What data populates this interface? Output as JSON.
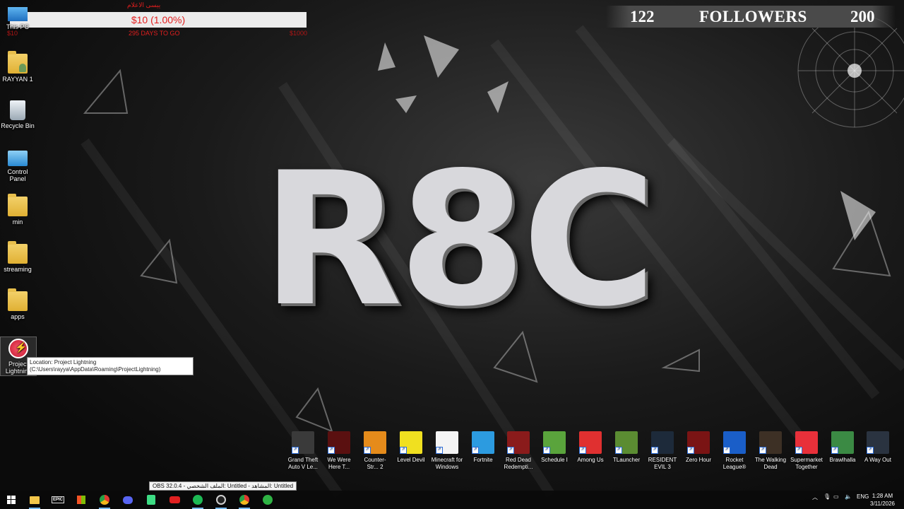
{
  "overlays": {
    "goal": {
      "top_label": "ييسى الاعلام",
      "bar_text": "$10 (1.00%)",
      "days_left": "295 DAYS TO GO",
      "left_value": "$10",
      "right_value": "$1000"
    },
    "followers": {
      "current": "122",
      "label": "FOLLOWERS",
      "goal": "200"
    }
  },
  "desktop_icons": [
    {
      "label": "This PC",
      "icon": "computer-icon"
    },
    {
      "label": "RAYYAN 1",
      "icon": "user-folder-icon"
    },
    {
      "label": "Recycle Bin",
      "icon": "recycle-bin-icon"
    },
    {
      "label": "Control Panel",
      "icon": "control-panel-icon"
    },
    {
      "label": "min",
      "icon": "folder-icon"
    },
    {
      "label": "streaming",
      "icon": "folder-icon"
    },
    {
      "label": "apps",
      "icon": "folder-icon"
    },
    {
      "label": "Project Lightning",
      "icon": "lightning-icon"
    }
  ],
  "tooltip": "Location: Project Lightning (C:\\Users\\rayya\\AppData\\Roaming\\ProjectLightning)",
  "wallpaper_logo": "R8C",
  "game_icons": [
    {
      "label": "Grand Theft Auto V Le...",
      "color": "#3a3a3a"
    },
    {
      "label": "We Were Here T...",
      "color": "#5a1010"
    },
    {
      "label": "Counter-Str... 2",
      "color": "#e58b1b"
    },
    {
      "label": "Level Devil",
      "color": "#f0e020"
    },
    {
      "label": "Minecraft for Windows",
      "color": "#f4f4f4"
    },
    {
      "label": "Fortnite",
      "color": "#2c9be0"
    },
    {
      "label": "Red Dead Redempti...",
      "color": "#8a1b1b"
    },
    {
      "label": "Schedule I",
      "color": "#5aa43c"
    },
    {
      "label": "Among Us",
      "color": "#e03030"
    },
    {
      "label": "TLauncher",
      "color": "#5b8c32"
    },
    {
      "label": "RESIDENT EVIL 3",
      "color": "#1d2a3a"
    },
    {
      "label": "Zero Hour",
      "color": "#7a1414"
    },
    {
      "label": "Rocket League®",
      "color": "#1a5ec8"
    },
    {
      "label": "The Walking Dead",
      "color": "#3d3025"
    },
    {
      "label": "Supermarket Together",
      "color": "#e8303a"
    },
    {
      "label": "Brawlhalla",
      "color": "#3b8a44"
    },
    {
      "label": "A Way Out",
      "color": "#2a3340"
    }
  ],
  "obs_tooltip": "OBS 32.0.4 - الملف الشخصي: Untitled - المشاهد: Untitled",
  "taskbar": {
    "buttons": [
      {
        "name": "start-icon",
        "color": "#ffffff"
      },
      {
        "name": "file-explorer-icon",
        "color": "#f3c64a"
      },
      {
        "name": "epic-games-icon",
        "color": "#dddddd"
      },
      {
        "name": "store-icon",
        "color": "#ffffff"
      },
      {
        "name": "chrome-icon",
        "color": "#e8b21b"
      },
      {
        "name": "discord-icon",
        "color": "#5865f2"
      },
      {
        "name": "android-studio-icon",
        "color": "#3ddc84"
      },
      {
        "name": "youtube-icon",
        "color": "#e02020"
      },
      {
        "name": "spotify-icon",
        "color": "#1db954"
      },
      {
        "name": "obs-icon",
        "color": "#d0d0d0"
      },
      {
        "name": "chrome-icon",
        "color": "#e8b21b"
      },
      {
        "name": "xbox-icon",
        "color": "#2fb344"
      }
    ],
    "epic_label": "EPIC",
    "tray_lang": "ENG",
    "time": "1:28 AM",
    "date": "3/11/2026"
  }
}
